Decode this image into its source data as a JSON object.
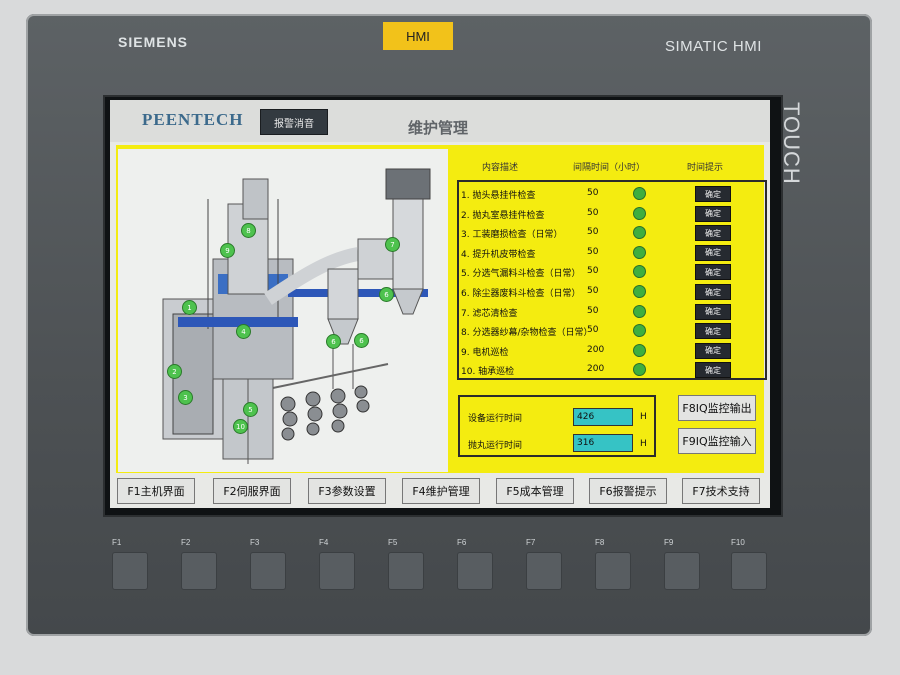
{
  "device": {
    "brand": "SIEMENS",
    "tag": "HMI",
    "model": "SIMATIC HMI",
    "side_label": "TOUCH",
    "hw_keys": [
      "F1",
      "F2",
      "F3",
      "F4",
      "F5",
      "F6",
      "F7",
      "F8",
      "F9",
      "F10"
    ]
  },
  "header": {
    "logo": "PEENTECH",
    "mute_button": "报警消音",
    "title": "维护管理"
  },
  "table": {
    "col_desc": "内容描述",
    "col_interval": "间隔时间（小时）",
    "col_hint": "时间提示",
    "rows": [
      {
        "desc": "1. 抛头悬挂件检查",
        "hours": "50",
        "status": "ok",
        "button": "确定"
      },
      {
        "desc": "2. 抛丸室悬挂件检查",
        "hours": "50",
        "status": "ok",
        "button": "确定"
      },
      {
        "desc": "3. 工装磨损检查（日常）",
        "hours": "50",
        "status": "ok",
        "button": "确定"
      },
      {
        "desc": "4. 提升机皮带检查",
        "hours": "50",
        "status": "ok",
        "button": "确定"
      },
      {
        "desc": "5. 分选气漏料斗检查（日常）",
        "hours": "50",
        "status": "ok",
        "button": "确定"
      },
      {
        "desc": "6. 除尘器废料斗检查（日常）",
        "hours": "50",
        "status": "ok",
        "button": "确定"
      },
      {
        "desc": "7. 滤芯清检查",
        "hours": "50",
        "status": "ok",
        "button": "确定"
      },
      {
        "desc": "8. 分选器纱幕/杂物检查（日常）",
        "hours": "50",
        "status": "ok",
        "button": "确定"
      },
      {
        "desc": "9. 电机巡检",
        "hours": "200",
        "status": "ok",
        "button": "确定"
      },
      {
        "desc": "10. 轴承巡检",
        "hours": "200",
        "status": "ok",
        "button": "确定"
      }
    ]
  },
  "runtime": {
    "equipment_label": "设备运行时间",
    "equipment_value": "426",
    "blast_label": "抛丸运行时间",
    "blast_value": "316",
    "unit": "H"
  },
  "monitor_buttons": {
    "output": "F8IQ监控输出",
    "input": "F9IQ监控输入"
  },
  "function_keys": [
    "F1主机界面",
    "F2伺服界面",
    "F3参数设置",
    "F4维护管理",
    "F5成本管理",
    "F6报警提示",
    "F7技术支持"
  ],
  "callouts": [
    "1",
    "2",
    "3",
    "4",
    "5",
    "6",
    "6",
    "6",
    "7",
    "8",
    "9",
    "10"
  ],
  "colors": {
    "panel_yellow": "#f4ec10",
    "status_green": "#3fae3f",
    "value_cyan": "#36c3c5",
    "hmi_tag": "#f2c21a"
  }
}
